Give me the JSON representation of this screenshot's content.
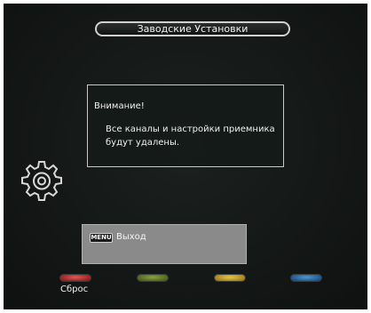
{
  "header": {
    "title": "Заводские Установки"
  },
  "dialog": {
    "title": "Внимание!",
    "message": "Все каналы и настройки приемника будут удалены."
  },
  "help": {
    "key_label": "MENU",
    "action_label": "Выход"
  },
  "color_buttons": [
    {
      "color": "red",
      "label": "Сброс"
    },
    {
      "color": "green",
      "label": ""
    },
    {
      "color": "yellow",
      "label": ""
    },
    {
      "color": "blue",
      "label": ""
    }
  ],
  "icons": {
    "settings": "gear-icon"
  }
}
